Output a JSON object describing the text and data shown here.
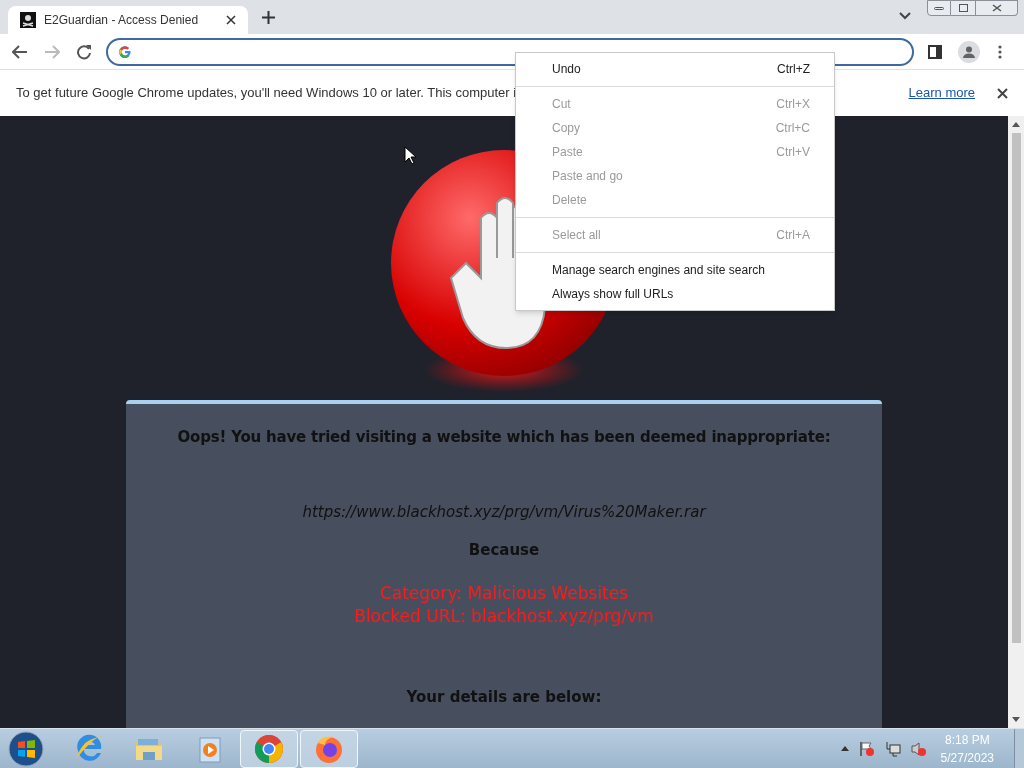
{
  "tab": {
    "title": "E2Guardian - Access Denied",
    "selected": true
  },
  "infobar": {
    "message": "To get future Google Chrome updates, you'll need Windows 10 or later. This computer i",
    "link": "Learn more"
  },
  "page": {
    "heading": "Oops! You have tried visiting a website which has been deemed inappropriate:",
    "url": "https://www.blackhost.xyz/prg/vm/Virus%20Maker.rar",
    "because": "Because",
    "reasons": [
      "Category: Malicious Websites",
      "Blocked URL: blackhost.xyz/prg/vm"
    ],
    "details": "Your details are below:"
  },
  "context_menu": {
    "groups": [
      [
        {
          "label": "Undo",
          "shortcut": "Ctrl+Z",
          "disabled": false
        }
      ],
      [
        {
          "label": "Cut",
          "shortcut": "Ctrl+X",
          "disabled": true
        },
        {
          "label": "Copy",
          "shortcut": "Ctrl+C",
          "disabled": true
        },
        {
          "label": "Paste",
          "shortcut": "Ctrl+V",
          "disabled": true
        },
        {
          "label": "Paste and go",
          "disabled": true
        },
        {
          "label": "Delete",
          "disabled": true
        }
      ],
      [
        {
          "label": "Select all",
          "shortcut": "Ctrl+A",
          "disabled": true
        }
      ],
      [
        {
          "label": "Manage search engines and site search",
          "disabled": false
        },
        {
          "label": "Always show full URLs",
          "disabled": false
        }
      ]
    ]
  },
  "taskbar": {
    "apps": [
      {
        "kind": "ie",
        "open": false
      },
      {
        "kind": "folder",
        "open": false
      },
      {
        "kind": "media",
        "open": false
      },
      {
        "kind": "chrome",
        "open": true
      },
      {
        "kind": "firefox",
        "open": true
      }
    ],
    "time": "8:18 PM",
    "date": "5/27/2023"
  }
}
